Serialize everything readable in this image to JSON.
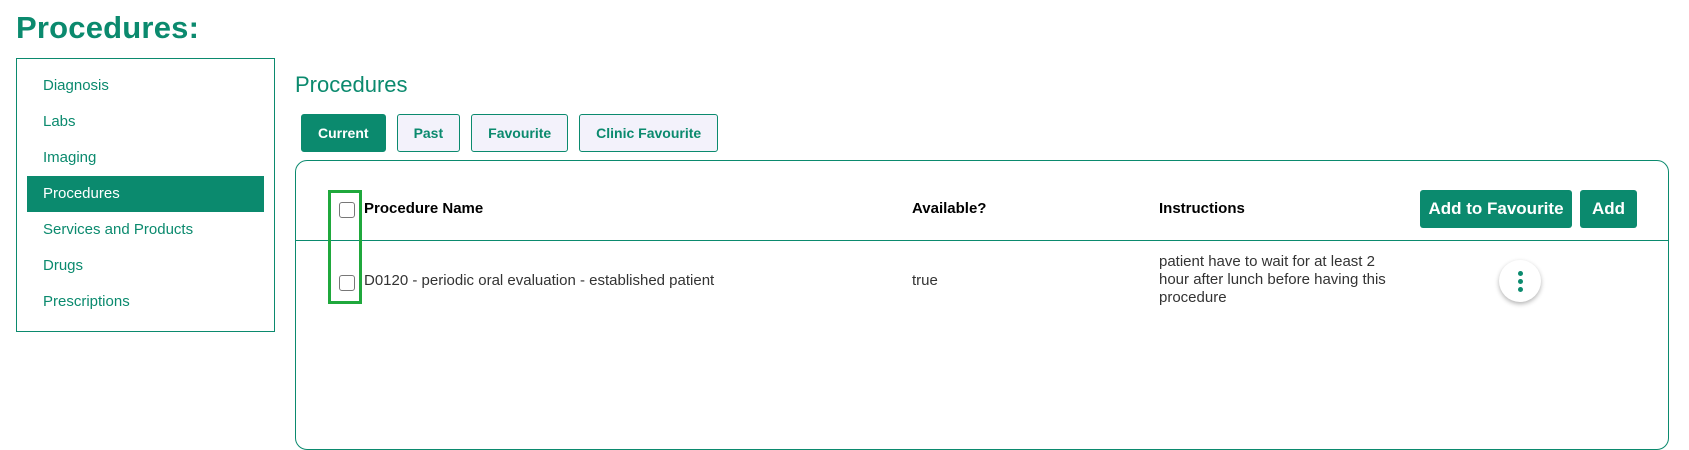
{
  "page_title": "Procedures:",
  "sidebar": {
    "items": [
      {
        "label": "Diagnosis",
        "active": false
      },
      {
        "label": "Labs",
        "active": false
      },
      {
        "label": "Imaging",
        "active": false
      },
      {
        "label": "Procedures",
        "active": true
      },
      {
        "label": "Services and Products",
        "active": false
      },
      {
        "label": "Drugs",
        "active": false
      },
      {
        "label": "Prescriptions",
        "active": false
      }
    ]
  },
  "section_title": "Procedures",
  "tabs": [
    {
      "label": "Current",
      "active": true
    },
    {
      "label": "Past",
      "active": false
    },
    {
      "label": "Favourite",
      "active": false
    },
    {
      "label": "Clinic Favourite",
      "active": false
    }
  ],
  "table": {
    "headers": {
      "procedure_name": "Procedure Name",
      "available": "Available?",
      "instructions": "Instructions"
    },
    "actions": {
      "add_to_favourite": "Add to Favourite",
      "add": "Add"
    },
    "rows": [
      {
        "procedure_name": "D0120 - periodic oral evaluation - established patient",
        "available": "true",
        "instructions": "patient have to wait for at least 2 hour after lunch before having this procedure"
      }
    ]
  },
  "colors": {
    "accent": "#0b8a6e",
    "highlight": "#1fa83c"
  },
  "icons": {
    "row_menu": "more-vertical-icon"
  }
}
